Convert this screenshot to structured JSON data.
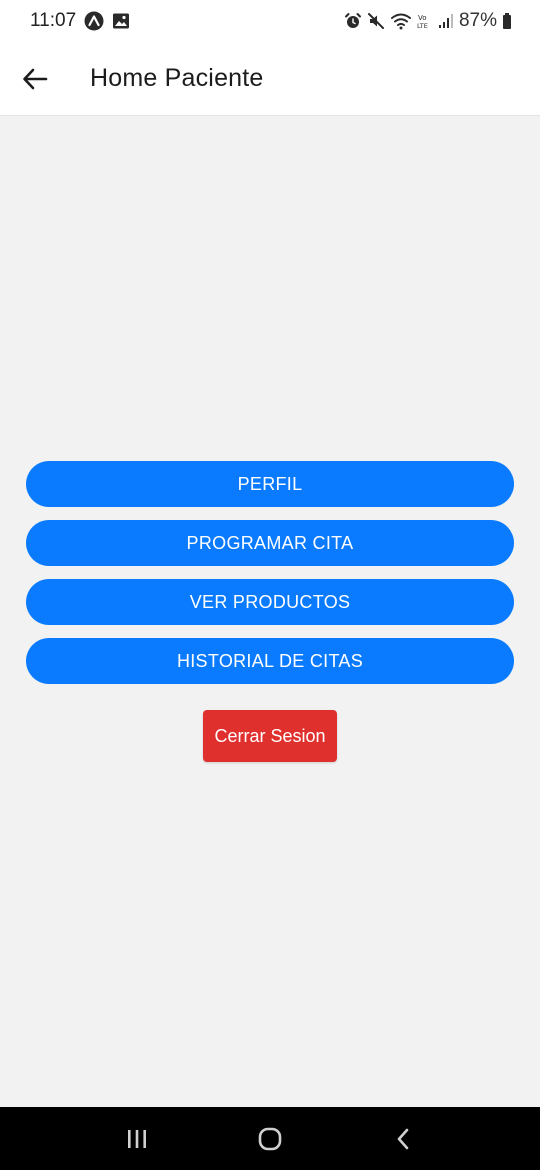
{
  "status_bar": {
    "time": "11:07",
    "battery": "87%",
    "icons": [
      "expo-app-icon",
      "image-notification-icon",
      "alarm-icon",
      "mute-icon",
      "wifi-icon",
      "volte-icon",
      "signal-icon",
      "battery-icon"
    ]
  },
  "app_bar": {
    "title": "Home Paciente",
    "back_icon": "arrow-left-icon"
  },
  "menu": {
    "perfil": "PERFIL",
    "programar_cita": "PROGRAMAR CITA",
    "ver_productos": "VER PRODUCTOS",
    "historial_citas": "HISTORIAL DE CITAS"
  },
  "logout": {
    "label": "Cerrar Sesion"
  },
  "colors": {
    "primary_button": "#0a7bff",
    "logout_button": "#e0302e",
    "background": "#f2f2f2"
  },
  "nav_bar": {
    "icons": [
      "recent-apps-icon",
      "home-icon",
      "back-icon"
    ]
  }
}
